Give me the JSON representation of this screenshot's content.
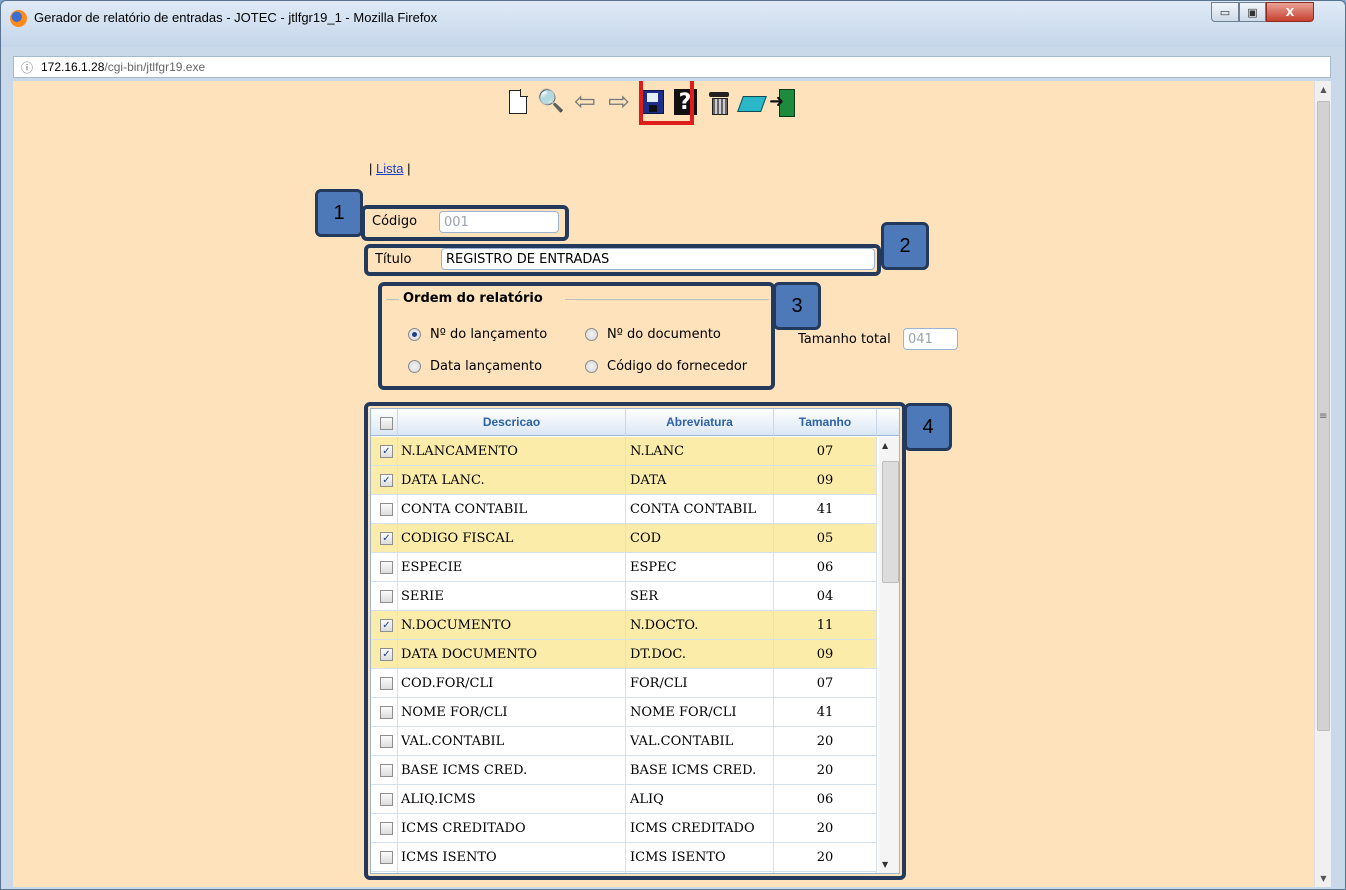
{
  "window": {
    "title": "Gerador de relatório de entradas - JOTEC - jtlfgr19_1 - Mozilla Firefox",
    "controls": {
      "minimize": "▭",
      "maximize": "▣",
      "close": "X"
    }
  },
  "urlbar": {
    "info_icon": "info-icon",
    "host": "172.16.1.28",
    "path": "/cgi-bin/jtlfgr19.exe"
  },
  "toolbar": {
    "icons": [
      "new-document-icon",
      "binoculars-icon",
      "back-arrow-icon",
      "forward-arrow-icon",
      "save-icon",
      "help-icon",
      "trash-icon",
      "eraser-icon",
      "exit-icon"
    ],
    "highlighted": "save-icon",
    "highlight_color": "#e01d1d"
  },
  "nav": {
    "prefix": "|",
    "link": "Lista",
    "suffix": "|"
  },
  "form": {
    "codigo_label": "Código",
    "codigo_value": "001",
    "titulo_label": "Título",
    "titulo_value": "REGISTRO DE ENTRADAS",
    "tamanho_label": "Tamanho total",
    "tamanho_value": "041"
  },
  "ordem": {
    "title": "Ordem do relatório",
    "options": [
      {
        "label": "Nº do lançamento",
        "checked": true
      },
      {
        "label": "Nº do documento",
        "checked": false
      },
      {
        "label": "Data lançamento",
        "checked": false
      },
      {
        "label": "Código do fornecedor",
        "checked": false
      }
    ]
  },
  "callouts": [
    "1",
    "2",
    "3",
    "4"
  ],
  "callout_color": "#4d79b8",
  "grid": {
    "headers": {
      "descricao": "Descricao",
      "abreviatura": "Abreviatura",
      "tamanho": "Tamanho"
    },
    "selected_color": "#fcecaa",
    "rows": [
      {
        "checked": true,
        "descricao": "N.LANCAMENTO",
        "abreviatura": "N.LANC",
        "tamanho": "07"
      },
      {
        "checked": true,
        "descricao": "DATA LANC.",
        "abreviatura": "DATA",
        "tamanho": "09"
      },
      {
        "checked": false,
        "descricao": "CONTA CONTABIL",
        "abreviatura": "CONTA CONTABIL",
        "tamanho": "41"
      },
      {
        "checked": true,
        "descricao": "CODIGO FISCAL",
        "abreviatura": "COD",
        "tamanho": "05"
      },
      {
        "checked": false,
        "descricao": "ESPECIE",
        "abreviatura": "ESPEC",
        "tamanho": "06"
      },
      {
        "checked": false,
        "descricao": "SERIE",
        "abreviatura": "SER",
        "tamanho": "04"
      },
      {
        "checked": true,
        "descricao": "N.DOCUMENTO",
        "abreviatura": "N.DOCTO.",
        "tamanho": "11"
      },
      {
        "checked": true,
        "descricao": "DATA DOCUMENTO",
        "abreviatura": "DT.DOC.",
        "tamanho": "09"
      },
      {
        "checked": false,
        "descricao": "COD.FOR/CLI",
        "abreviatura": "FOR/CLI",
        "tamanho": "07"
      },
      {
        "checked": false,
        "descricao": "NOME FOR/CLI",
        "abreviatura": "NOME FOR/CLI",
        "tamanho": "41"
      },
      {
        "checked": false,
        "descricao": "VAL.CONTABIL",
        "abreviatura": "VAL.CONTABIL",
        "tamanho": "20"
      },
      {
        "checked": false,
        "descricao": "BASE ICMS CRED.",
        "abreviatura": "BASE ICMS CRED.",
        "tamanho": "20"
      },
      {
        "checked": false,
        "descricao": "ALIQ.ICMS",
        "abreviatura": "ALIQ",
        "tamanho": "06"
      },
      {
        "checked": false,
        "descricao": "ICMS CREDITADO",
        "abreviatura": "ICMS CREDITADO",
        "tamanho": "20"
      },
      {
        "checked": false,
        "descricao": "ICMS ISENTO",
        "abreviatura": "ICMS ISENTO",
        "tamanho": "20"
      },
      {
        "checked": false,
        "descricao": "",
        "abreviatura": "",
        "tamanho": ""
      }
    ]
  }
}
